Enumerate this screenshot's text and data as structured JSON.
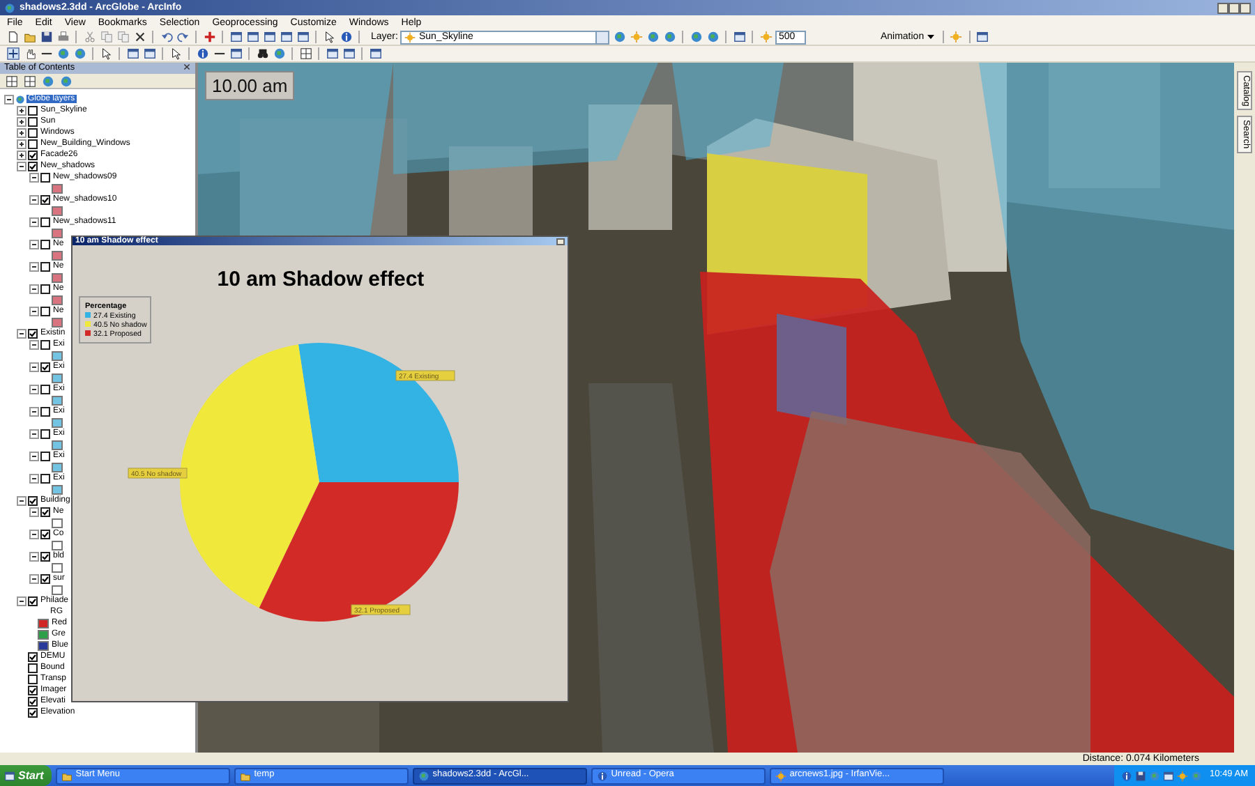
{
  "window": {
    "title": "shadows2.3dd - ArcGlobe - ArcInfo"
  },
  "menu": [
    "File",
    "Edit",
    "View",
    "Bookmarks",
    "Selection",
    "Geoprocessing",
    "Customize",
    "Windows",
    "Help"
  ],
  "toolbar": {
    "layer_label": "Layer:",
    "layer_value": "Sun_Skyline",
    "scale_value": "500",
    "animation_button": "Animation"
  },
  "toc": {
    "title": "Table of Contents",
    "tree": [
      {
        "kind": "group",
        "label": "Globe layers",
        "selected": true,
        "expanded": true,
        "children": [
          {
            "kind": "layer",
            "label": "Sun_Skyline",
            "checked": false,
            "selected": false,
            "expanded": false
          },
          {
            "kind": "layer",
            "label": "Sun",
            "checked": false,
            "selected": false,
            "expanded": false
          },
          {
            "kind": "layer",
            "label": "Windows",
            "checked": false,
            "selected": false,
            "expanded": false
          },
          {
            "kind": "layer",
            "label": "New_Building_Windows",
            "checked": false,
            "selected": false,
            "expanded": false
          },
          {
            "kind": "layer",
            "label": "Facade26",
            "checked": true,
            "selected": false,
            "expanded": false
          },
          {
            "kind": "layer",
            "label": "New_shadows",
            "checked": true,
            "selected": false,
            "expanded": true,
            "children": [
              {
                "kind": "layer",
                "label": "New_shadows09",
                "checked": false,
                "selected": false,
                "expanded": true,
                "color": "#d9737f"
              },
              {
                "kind": "layer",
                "label": "New_shadows10",
                "checked": true,
                "selected": false,
                "expanded": true,
                "color": "#d9737f"
              },
              {
                "kind": "layer",
                "label": "New_shadows11",
                "checked": false,
                "selected": false,
                "expanded": true,
                "color": "#d9737f"
              },
              {
                "kind": "layer",
                "label": "Ne",
                "checked": false,
                "selected": false,
                "expanded": true,
                "color": "#d9737f"
              },
              {
                "kind": "layer",
                "label": "Ne",
                "checked": false,
                "selected": false,
                "expanded": true,
                "color": "#d9737f"
              },
              {
                "kind": "layer",
                "label": "Ne",
                "checked": false,
                "selected": false,
                "expanded": true,
                "color": "#d9737f"
              },
              {
                "kind": "layer",
                "label": "Ne",
                "checked": false,
                "selected": false,
                "expanded": true,
                "color": "#d9737f"
              }
            ]
          },
          {
            "kind": "layer",
            "label": "Existin",
            "checked": true,
            "selected": false,
            "expanded": true,
            "children": [
              {
                "kind": "layer",
                "label": "Exi",
                "checked": false,
                "selected": false,
                "expanded": true,
                "color": "#72c4e2"
              },
              {
                "kind": "layer",
                "label": "Exi",
                "checked": true,
                "selected": false,
                "expanded": true,
                "color": "#72c4e2"
              },
              {
                "kind": "layer",
                "label": "Exi",
                "checked": false,
                "selected": false,
                "expanded": true,
                "color": "#72c4e2"
              },
              {
                "kind": "layer",
                "label": "Exi",
                "checked": false,
                "selected": false,
                "expanded": true,
                "color": "#72c4e2"
              },
              {
                "kind": "layer",
                "label": "Exi",
                "checked": false,
                "selected": false,
                "expanded": true,
                "color": "#72c4e2"
              },
              {
                "kind": "layer",
                "label": "Exi",
                "checked": false,
                "selected": false,
                "expanded": true,
                "color": "#72c4e2"
              },
              {
                "kind": "layer",
                "label": "Exi",
                "checked": false,
                "selected": false,
                "expanded": true,
                "color": "#72c4e2"
              }
            ]
          },
          {
            "kind": "layer",
            "label": "Building",
            "checked": true,
            "selected": false,
            "expanded": true,
            "children": [
              {
                "kind": "layer",
                "label": "Ne",
                "checked": true,
                "selected": false,
                "expanded": true,
                "color": "#ffffff"
              },
              {
                "kind": "layer",
                "label": "Co",
                "checked": true,
                "selected": false,
                "expanded": true,
                "color": "#ffffff"
              },
              {
                "kind": "layer",
                "label": "bld",
                "checked": true,
                "selected": false,
                "expanded": true,
                "color": "#ffffff"
              },
              {
                "kind": "layer",
                "label": "sur",
                "checked": true,
                "selected": false,
                "expanded": true,
                "color": "#ffffff"
              }
            ]
          },
          {
            "kind": "layer",
            "label": "Philade",
            "checked": true,
            "selected": false,
            "expanded": true,
            "children": [
              {
                "kind": "note",
                "label": "RG"
              },
              {
                "kind": "band",
                "label": "Red",
                "color": "#d02626"
              },
              {
                "kind": "band",
                "label": "Gre",
                "color": "#2ea04a"
              },
              {
                "kind": "band",
                "label": "Blue",
                "color": "#2a3a9a"
              }
            ]
          },
          {
            "kind": "layer",
            "label": "DEMU",
            "checked": true,
            "selected": false
          },
          {
            "kind": "layer",
            "label": "Bound",
            "checked": false,
            "selected": false
          },
          {
            "kind": "layer",
            "label": "Transp",
            "checked": false,
            "selected": false
          },
          {
            "kind": "layer",
            "label": "Imager",
            "checked": true,
            "selected": false
          },
          {
            "kind": "layer",
            "label": "Elevati",
            "checked": true,
            "selected": false
          },
          {
            "kind": "layer",
            "label": "Elevation",
            "checked": true,
            "selected": false
          }
        ]
      }
    ]
  },
  "scene": {
    "time_label": "10.00 am"
  },
  "side_tabs": [
    "Catalog",
    "Search"
  ],
  "chart_window": {
    "title": "10 am Shadow effect",
    "legend": {
      "title": "Percentage",
      "items": [
        {
          "label": "27.4 Existing",
          "color": "#33b2e4"
        },
        {
          "label": "40.5 No shadow",
          "color": "#f0e83a"
        },
        {
          "label": "32.1 Proposed",
          "color": "#d22b27"
        }
      ]
    },
    "chart_data": {
      "type": "pie",
      "title": "10 am Shadow effect",
      "categories": [
        "27.4 Existing",
        "40.5 No shadow",
        "32.1 Proposed"
      ],
      "values": [
        27.4,
        40.5,
        32.1
      ]
    }
  },
  "status_bar": {
    "text": "Distance: 0.074 Kilometers"
  },
  "taskbar": {
    "start": "Start",
    "buttons": [
      {
        "label": "Start Menu",
        "selected": false
      },
      {
        "label": "temp",
        "selected": false
      },
      {
        "label": "shadows2.3dd - ArcGl...",
        "selected": true
      },
      {
        "label": "Unread - Opera",
        "selected": false
      },
      {
        "label": "arcnews1.jpg - IrfanVie...",
        "selected": false
      }
    ],
    "clock": "10:49 AM"
  }
}
